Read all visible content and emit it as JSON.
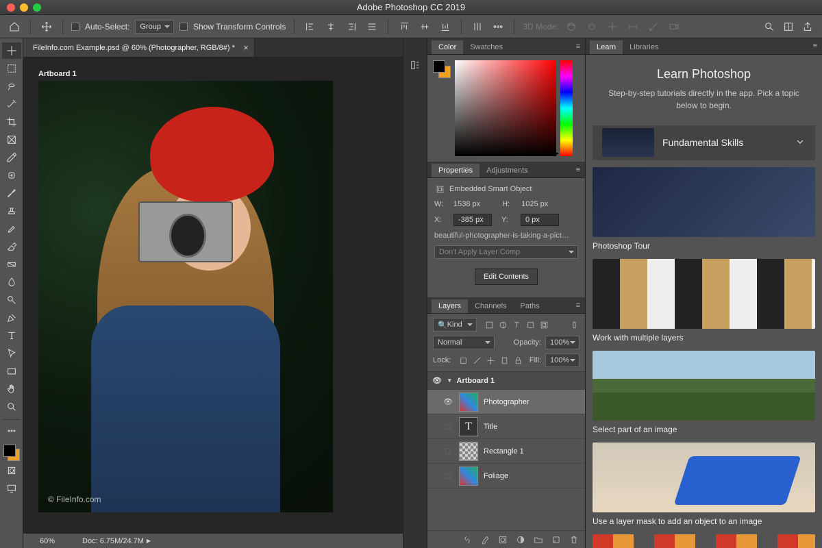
{
  "app": {
    "title": "Adobe Photoshop CC 2019"
  },
  "options": {
    "auto_select_label": "Auto-Select:",
    "auto_select_value": "Group",
    "show_transform_label": "Show Transform Controls",
    "mode3d_label": "3D Mode:"
  },
  "document": {
    "tab_title": "FileInfo.com Example.psd @ 60% (Photographer, RGB/8#) *",
    "artboard_label": "Artboard 1",
    "watermark": "© FileInfo.com",
    "zoom": "60%",
    "doc_size": "Doc: 6.75M/24.7M"
  },
  "panels": {
    "color": {
      "tabs": [
        "Color",
        "Swatches"
      ]
    },
    "properties": {
      "tabs": [
        "Properties",
        "Adjustments"
      ],
      "type_label": "Embedded Smart Object",
      "W_label": "W:",
      "W": "1538 px",
      "H_label": "H:",
      "H": "1025 px",
      "X_label": "X:",
      "X": "-385 px",
      "Y_label": "Y:",
      "Y": "0 px",
      "filename": "beautiful-photographer-is-taking-a-pict…",
      "layer_comp": "Don't Apply Layer Comp",
      "edit_btn": "Edit Contents"
    },
    "layers": {
      "tabs": [
        "Layers",
        "Channels",
        "Paths"
      ],
      "kind": "Kind",
      "blend": "Normal",
      "opacity_label": "Opacity:",
      "opacity": "100%",
      "lock_label": "Lock:",
      "fill_label": "Fill:",
      "fill": "100%",
      "items": [
        {
          "name": "Artboard 1",
          "group": true,
          "visible": true
        },
        {
          "name": "Photographer",
          "visible": true,
          "selected": true,
          "thumb": "colorful"
        },
        {
          "name": "Title",
          "visible": false,
          "thumb": "T"
        },
        {
          "name": "Rectangle 1",
          "visible": false,
          "thumb": "checker"
        },
        {
          "name": "Foliage",
          "visible": false,
          "thumb": "colorful"
        }
      ]
    }
  },
  "learn": {
    "tabs": [
      "Learn",
      "Libraries"
    ],
    "heading": "Learn Photoshop",
    "sub": "Step-by-step tutorials directly in the app. Pick a topic below to begin.",
    "accordion": "Fundamental Skills",
    "cards": [
      {
        "label": "Photoshop Tour",
        "cls": "tour"
      },
      {
        "label": "Work with multiple layers",
        "cls": "layers"
      },
      {
        "label": "Select part of an image",
        "cls": "select"
      },
      {
        "label": "Use a layer mask to add an object to an image",
        "cls": "mask"
      }
    ]
  }
}
